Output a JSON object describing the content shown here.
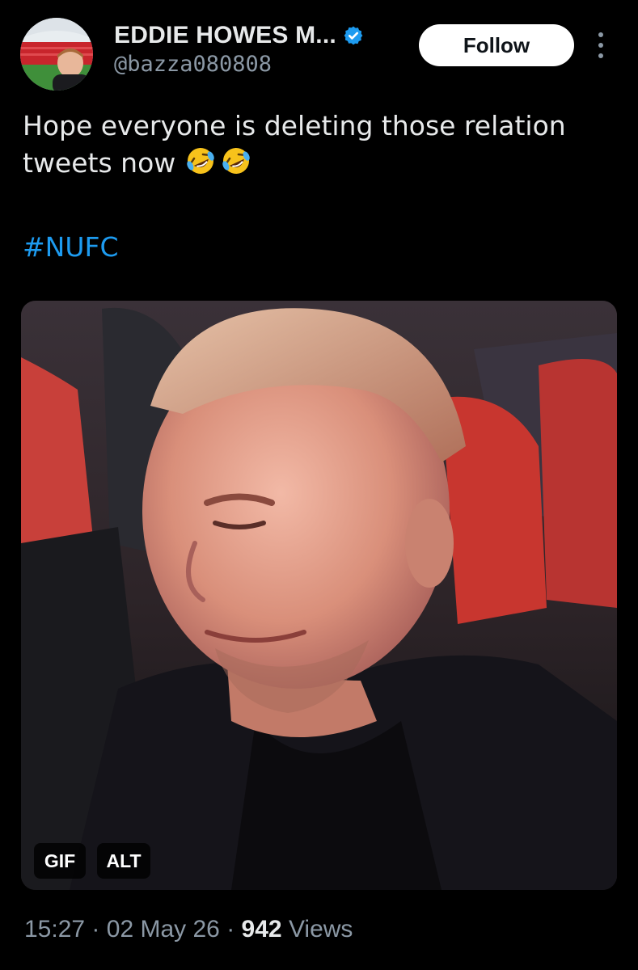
{
  "author": {
    "display_name": "EDDIE HOWES M...",
    "handle": "@bazza080808",
    "verified": true,
    "avatar_icon": "avatar-stadium-photo"
  },
  "actions": {
    "follow_label": "Follow",
    "more_icon": "vertical-ellipsis-icon"
  },
  "tweet": {
    "text": "Hope everyone is deleting those relation tweets now",
    "emoji_icon": "rolling-on-floor-laughing-emoji",
    "emoji_count": 2,
    "hashtag": "#NUFC"
  },
  "media": {
    "type_badge": "GIF",
    "alt_badge": "ALT"
  },
  "meta": {
    "time": "15:27",
    "separator_1": "·",
    "date": "02 May 26",
    "separator_2": "·",
    "views_count": "942",
    "views_label": "Views"
  },
  "colors": {
    "background": "#000000",
    "text_primary": "#e7e9ea",
    "text_secondary": "#8b98a5",
    "link": "#1d9bf0",
    "verified": "#1d9bf0"
  }
}
